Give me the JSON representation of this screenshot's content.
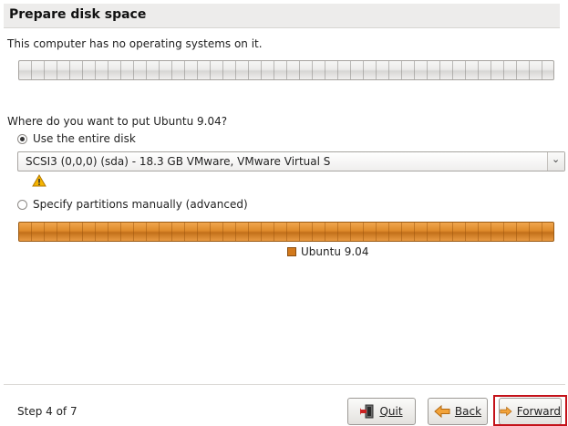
{
  "page": {
    "title": "Prepare disk space",
    "intro": "This computer has no operating systems on it.",
    "question": "Where do you want to put Ubuntu 9.04?"
  },
  "options": {
    "entire_disk_label": "Use the entire disk",
    "entire_disk_selected": true,
    "disk_selected": "SCSI3 (0,0,0) (sda) - 18.3 GB VMware, VMware Virtual S",
    "manual_label": "Specify partitions manually (advanced)",
    "manual_selected": false
  },
  "legend": {
    "label": "Ubuntu 9.04",
    "color": "#d2791c"
  },
  "footer": {
    "step": "Step 4 of 7",
    "quit_label": "Quit",
    "back_label": "Back",
    "forward_label": "Forward"
  },
  "icons": {
    "warning": "warning-icon",
    "quit": "quit-icon",
    "back": "back-arrow-icon",
    "forward": "forward-arrow-icon"
  }
}
